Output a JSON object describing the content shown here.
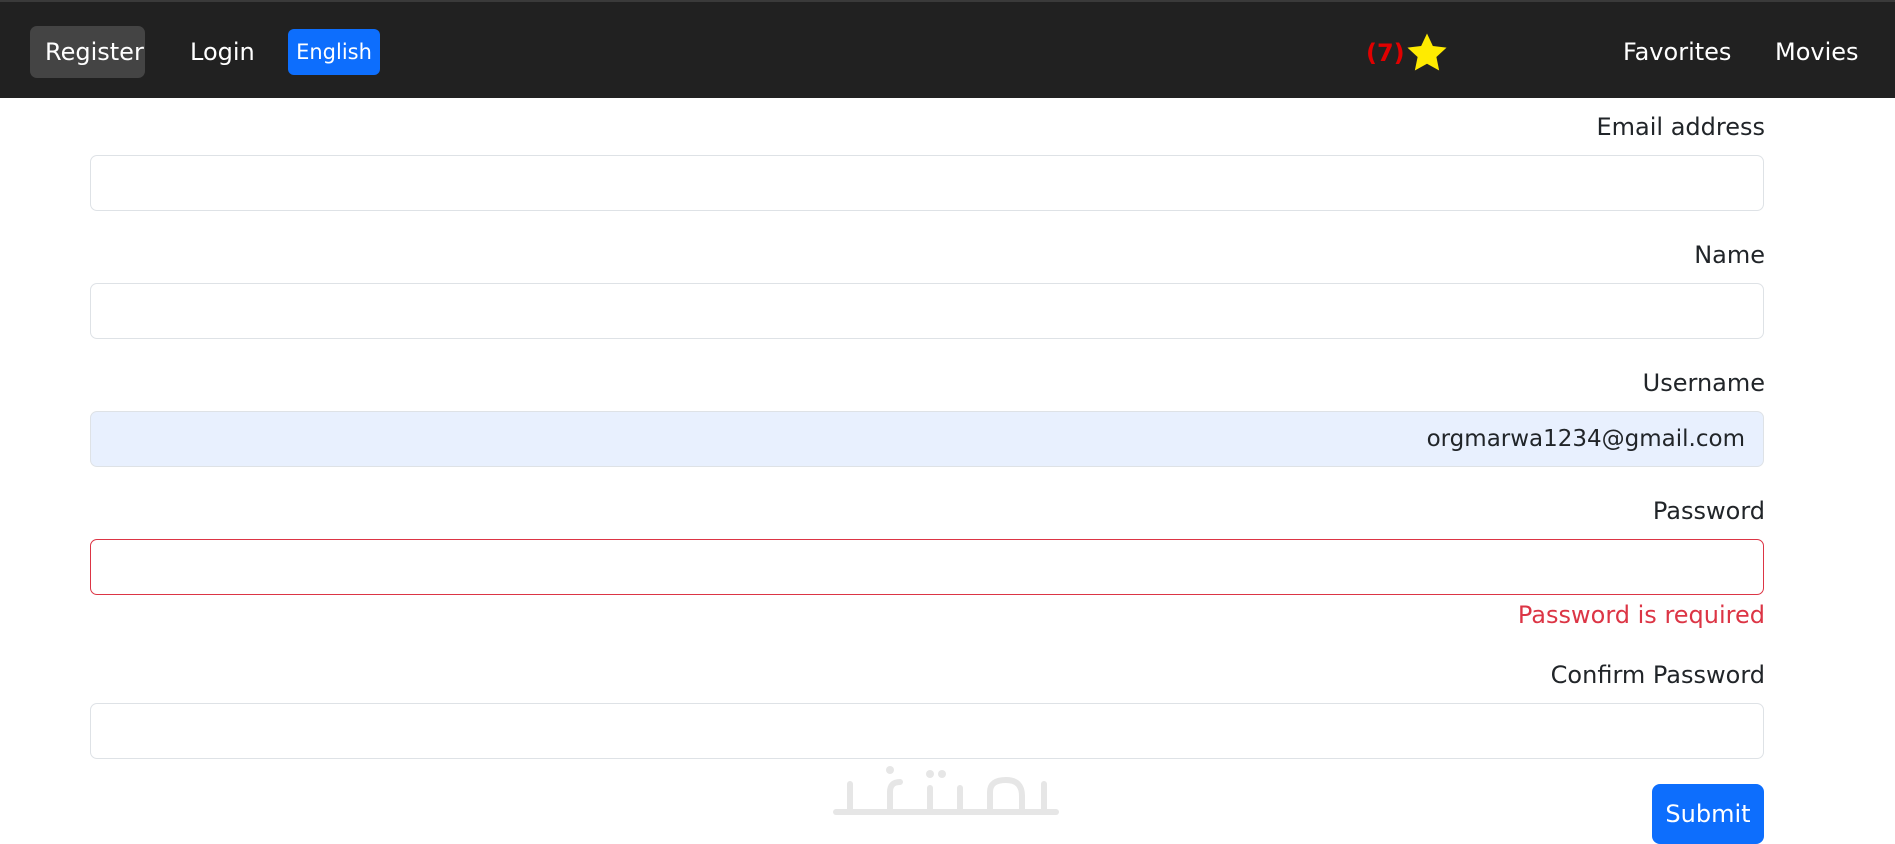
{
  "navbar": {
    "register_label": "Register",
    "login_label": "Login",
    "language_label": "English",
    "favorites_count": "(7)",
    "favorites_label": "Favorites",
    "movies_label": "Movies"
  },
  "form": {
    "email": {
      "label": "Email address",
      "value": ""
    },
    "name": {
      "label": "Name",
      "value": ""
    },
    "username": {
      "label": "Username",
      "value": "orgmarwa1234@gmail.com"
    },
    "password": {
      "label": "Password",
      "value": "",
      "error": "Password is required"
    },
    "confirm_password": {
      "label": "Confirm Password",
      "value": ""
    },
    "submit_label": "Submit"
  },
  "watermark": "خمسات",
  "colors": {
    "navbar_bg": "#212121",
    "accent": "#0d6efd",
    "error": "#dc3545",
    "star": "#ffeb00",
    "favorites_count": "#e00000",
    "autofill_bg": "#e8f0fe"
  },
  "icons": {
    "favorites": "star-icon"
  }
}
